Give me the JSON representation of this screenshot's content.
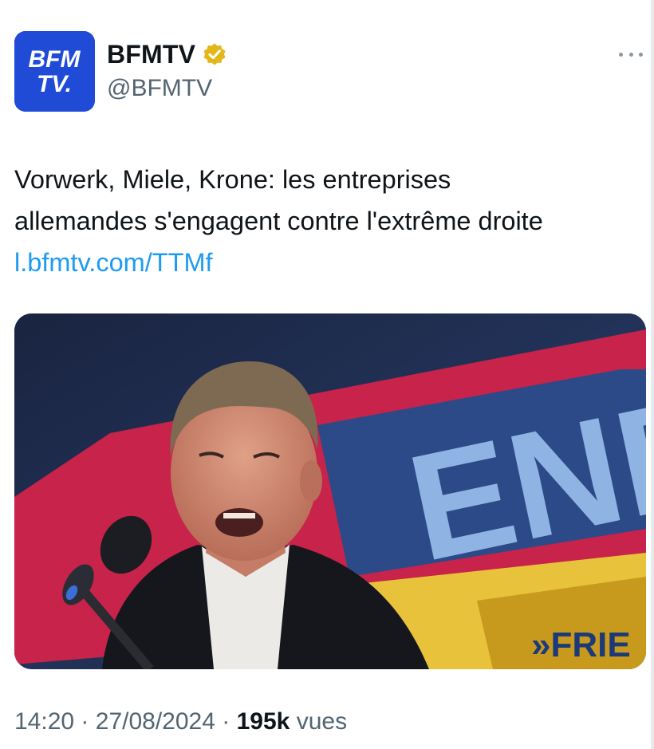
{
  "account": {
    "display_name": "BFMTV",
    "handle": "@BFMTV",
    "avatar_text_line1": "BFM",
    "avatar_text_line2": "TV."
  },
  "tweet": {
    "text_line1": "Vorwerk, Miele, Krone: les entreprises",
    "text_line2": "allemandes s'engagent contre l'extrême droite",
    "link": "l.bfmtv.com/TTMf"
  },
  "media": {
    "banner_text": "END",
    "banner_sub": "»FRIE"
  },
  "footer": {
    "time": "14:20",
    "separator": "·",
    "date": "27/08/2024",
    "views": "195k",
    "views_label": "vues"
  },
  "colors": {
    "brand_blue": "#1f4bd6",
    "link_blue": "#1d9bf0",
    "verified_gold": "#e2b719"
  }
}
